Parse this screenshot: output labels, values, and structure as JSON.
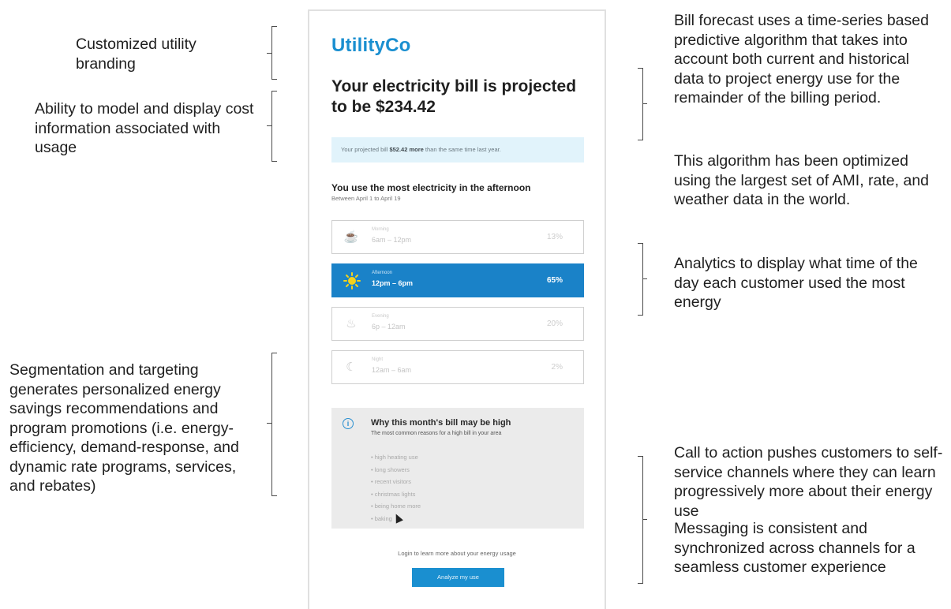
{
  "annotations": {
    "branding": "Customized utility branding",
    "cost_model": "Ability to model and display cost information associated with usage",
    "forecast": "Bill forecast uses a time-series based predictive algorithm that takes into account both current and historical data to project energy use for the remainder of the billing period.",
    "algorithm": "This algorithm has been optimized using the largest set of AMI, rate, and weather data in the world.",
    "analytics": "Analytics to display what time of the day each customer used the most energy",
    "segmentation": "Segmentation and targeting generates personalized energy savings recommendations and program promotions  (i.e. energy-efficiency, demand-response, and dynamic rate programs, services, and rebates)",
    "cta": "Call to action pushes customers to self-service channels where they can learn progressively more about their energy use",
    "messaging": "Messaging is consistent and synchronized across channels for a seamless customer experience"
  },
  "email": {
    "brand": "UtilityCo",
    "headline": "Your electricity bill is projected to be $234.42",
    "projection": {
      "prefix": "Your projected bill",
      "amount": "$52.42 more",
      "suffix": "than the same time last year."
    },
    "usage_title": "You use the most electricity in the afternoon",
    "usage_subtitle": "Between April 1 to April 19",
    "slots": [
      {
        "label": "Morning",
        "range": "6am – 12pm",
        "percent": "13%",
        "icon": "coffee-icon",
        "active": false
      },
      {
        "label": "Afternoon",
        "range": "12pm – 6pm",
        "percent": "65%",
        "icon": "sun-icon",
        "active": true
      },
      {
        "label": "Evening",
        "range": "6p – 12am",
        "percent": "20%",
        "icon": "dinner-icon",
        "active": false
      },
      {
        "label": "Night",
        "range": "12am – 6am",
        "percent": "2%",
        "icon": "moon-icon",
        "active": false
      }
    ],
    "why": {
      "title": "Why this month's bill may be high",
      "subtitle": "The most common reasons for a high bill in your area",
      "reasons": [
        "high heating use",
        "long showers",
        "recent visitors",
        "christmas lights",
        "being home more",
        "baking"
      ]
    },
    "login_text": "Login to learn more about your energy usage",
    "cta_label": "Analyze my use"
  }
}
